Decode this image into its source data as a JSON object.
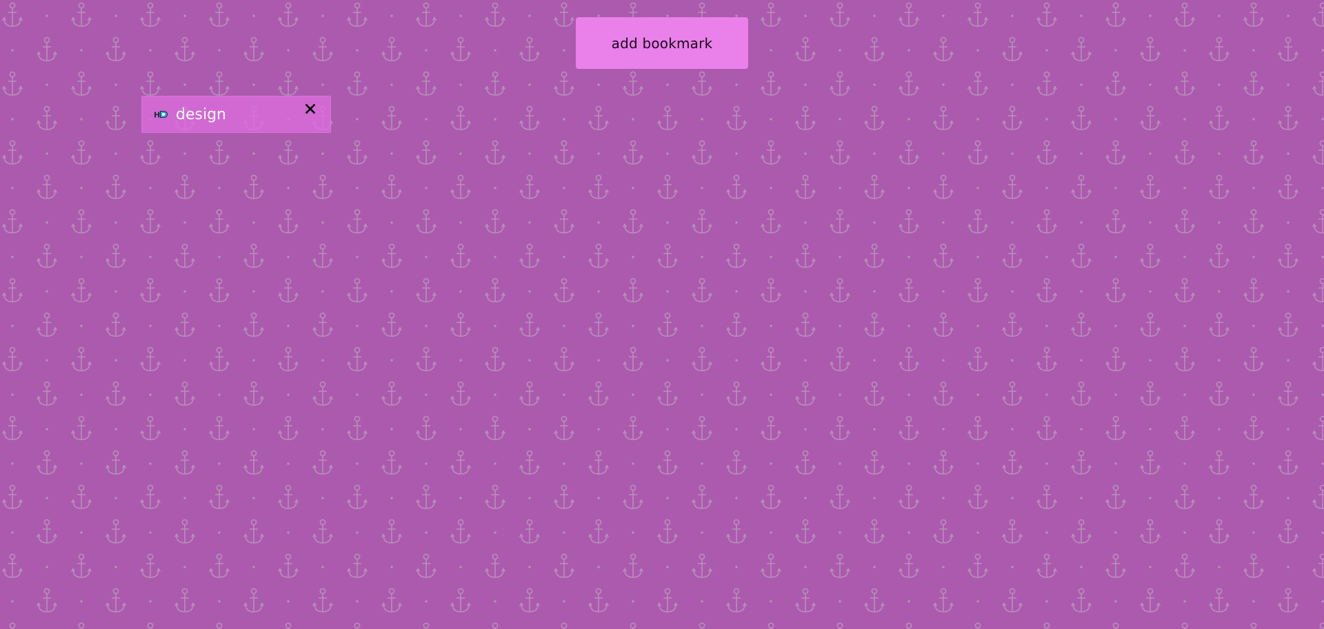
{
  "app": {
    "background_color": "#ab5aae",
    "pattern_icon": "anchor-icon",
    "pattern_color": "#b98fba"
  },
  "toolbar": {
    "add_label": "add bookmark",
    "add_button_color": "#ea80ea"
  },
  "bookmarks": [
    {
      "label": "design",
      "favicon": "hd-logo-icon",
      "close_icon": "close-icon",
      "background_color": "#d46cd6"
    }
  ]
}
